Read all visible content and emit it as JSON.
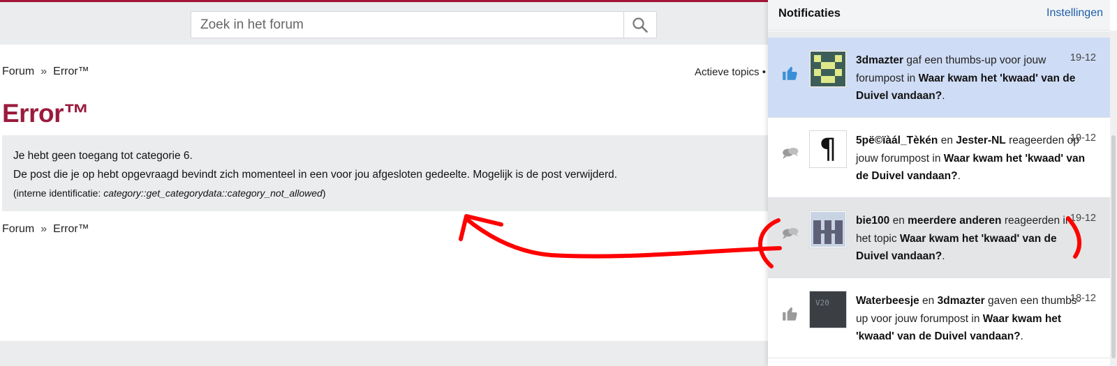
{
  "search": {
    "placeholder": "Zoek in het forum",
    "icon": "search-icon"
  },
  "breadcrumb": {
    "forum": "Forum",
    "separator": "»",
    "current": "Error™"
  },
  "nav": {
    "actieve_topics": "Actieve topics",
    "dot": "•"
  },
  "page": {
    "title": "Error™",
    "error_line1": "Je hebt geen toegang tot categorie 6.",
    "error_line2": "De post die je op hebt opgevraagd bevindt zich momenteel in een voor jou afgesloten gedeelte. Mogelijk is de post verwijderd.",
    "tech_prefix": "(interne identificatie: ",
    "tech_code": "category::get_categorydata::category_not_allowed",
    "tech_suffix": ")"
  },
  "notifications": {
    "title": "Notificaties",
    "settings": "Instellingen",
    "items": [
      {
        "icon": "thumbs-up-icon",
        "avatar": "pixel-face-avatar",
        "user1": "3dmazter",
        "join": "",
        "user2": "",
        "action": " gaf een thumbs-up voor jouw forumpost in ",
        "topic": "Waar kwam het 'kwaad' van de Duivel vandaan?",
        "end": ".",
        "date": "19-12",
        "highlight": "#cfdcf5"
      },
      {
        "icon": "comments-icon",
        "avatar": "pilcrow-avatar",
        "avatar_text": "¶",
        "user1": "5pë©ïàál_Tèkén",
        "join": " en ",
        "user2": "Jester-NL",
        "action": " reageerden op jouw forumpost in ",
        "topic": "Waar kwam het 'kwaad' van de Duivel vandaan?",
        "end": ".",
        "date": "19-12",
        "highlight": "#ffffff"
      },
      {
        "icon": "comments-icon",
        "avatar": "letter-h-avatar",
        "user1": "bie100",
        "join": " en ",
        "user2": "meerdere anderen",
        "action": " reageerden in het topic ",
        "topic": "Waar kwam het 'kwaad' van de Duivel vandaan?",
        "end": ".",
        "date": "19-12",
        "highlight": "#e4e5e7"
      },
      {
        "icon": "thumbs-up-icon",
        "avatar": "v20-photo-avatar",
        "avatar_text": "V20",
        "user1": "Waterbeesje",
        "join": " en ",
        "user2": "3dmazter",
        "action": " gaven een thumbs-up voor jouw forumpost in ",
        "topic": "Waar kwam het 'kwaad' van de Duivel vandaan?",
        "end": ".",
        "date": "18-12",
        "highlight": "#ffffff"
      }
    ]
  },
  "colors": {
    "accent": "#9b1b3d",
    "link": "#1c5ea8",
    "annotation": "#ff0000"
  }
}
